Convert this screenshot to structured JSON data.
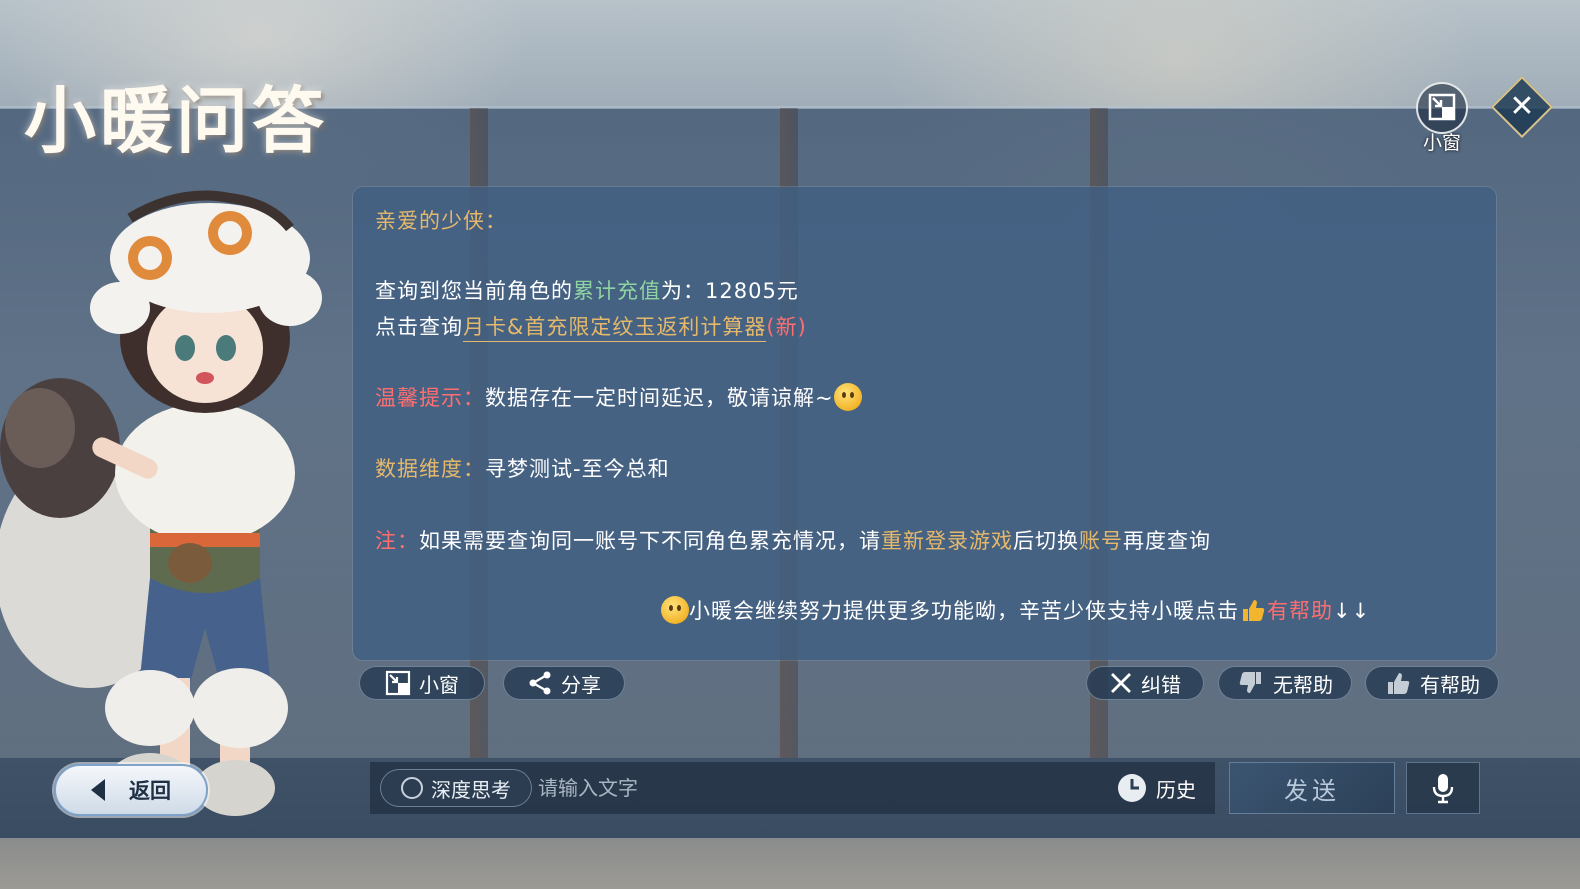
{
  "title": "小暖问答",
  "top_controls": {
    "mini_window_label": "小窗"
  },
  "message": {
    "greeting": "亲爱的少侠：",
    "query_prefix": "查询到您当前角色的",
    "query_highlight": "累计充值",
    "query_suffix": "为：12805元",
    "click_prefix": "点击查询",
    "calculator_link": "月卡&首充限定纹玉返利计算器",
    "calculator_new": "(新)",
    "tip_label": "温馨提示：",
    "tip_text": "数据存在一定时间延迟，敬请谅解~",
    "dimension_label": "数据维度：",
    "dimension_text": "寻梦测试-至今总和",
    "note_label": "注：",
    "note_prefix": "如果需要查询同一账号下不同角色累充情况，请",
    "note_highlight1": "重新登录游戏",
    "note_middle": "后切换",
    "note_highlight2": "账号",
    "note_suffix": "再度查询",
    "footer_text": "小暖会继续努力提供更多功能呦，辛苦少侠支持小暖点击",
    "footer_helpful": "有帮助",
    "footer_arrows": "↓↓"
  },
  "actions": {
    "mini_window": "小窗",
    "share": "分享",
    "correct": "纠错",
    "not_helpful": "无帮助",
    "helpful": "有帮助"
  },
  "bottom": {
    "back": "返回",
    "deep_think": "深度思考",
    "input_placeholder": "请输入文字",
    "input_value": "",
    "history": "历史",
    "send": "发送"
  },
  "colors": {
    "gold": "#e6b86a",
    "green": "#8fd3a3",
    "red": "#ff6f6f",
    "card": "#415f82"
  },
  "icons": {
    "emoji": "kiss-face-emoji",
    "thumb": "thumbs-up-emoji",
    "mic": "microphone-icon",
    "history": "clock-icon",
    "close": "close-icon",
    "mini_window": "minimize-window-icon",
    "share": "share-icon"
  }
}
